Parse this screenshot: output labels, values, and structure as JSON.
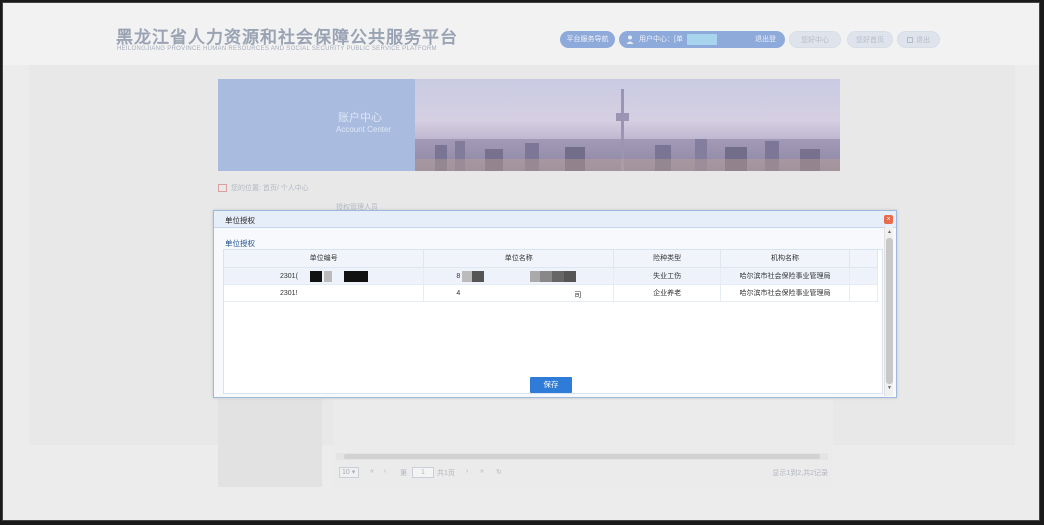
{
  "header": {
    "title_cn": "黑龙江省人力资源和社会保障公共服务平台",
    "title_en": "HEILONGJIANG PROVINCE HUMAN RESOURCES AND SOCIAL SECURITY PUBLIC SERVICE PLATFORM",
    "nav_pill": "平台服务导航",
    "user_prefix": "用户中心：[单",
    "logout": "退出登",
    "btn_a": "您好中心",
    "btn_b": "您好首页",
    "btn_c": "退出"
  },
  "banner": {
    "title": "账户中心",
    "subtitle": "Account Center"
  },
  "breadcrumb": "您的位置: 首页/ 个人中心",
  "under_tab": "授权管理人员",
  "pager": {
    "page_size": "10",
    "page_label": "第",
    "page_value": "1",
    "total_pages": "共1页",
    "summary": "显示1到2,共2记录"
  },
  "dialog": {
    "title": "单位授权",
    "section": "单位授权",
    "columns": [
      "单位编号",
      "单位名称",
      "险种类型",
      "机构名称"
    ],
    "rows": [
      {
        "code": "2301(",
        "name_prefix": "8",
        "insurance": "失业工伤",
        "org": "哈尔滨市社会保险事业管理局"
      },
      {
        "code": "2301!",
        "name_prefix": "4",
        "name_suffix": "司",
        "insurance": "企业养老",
        "org": "哈尔滨市社会保险事业管理局"
      }
    ],
    "save": "保存",
    "close": "×"
  }
}
